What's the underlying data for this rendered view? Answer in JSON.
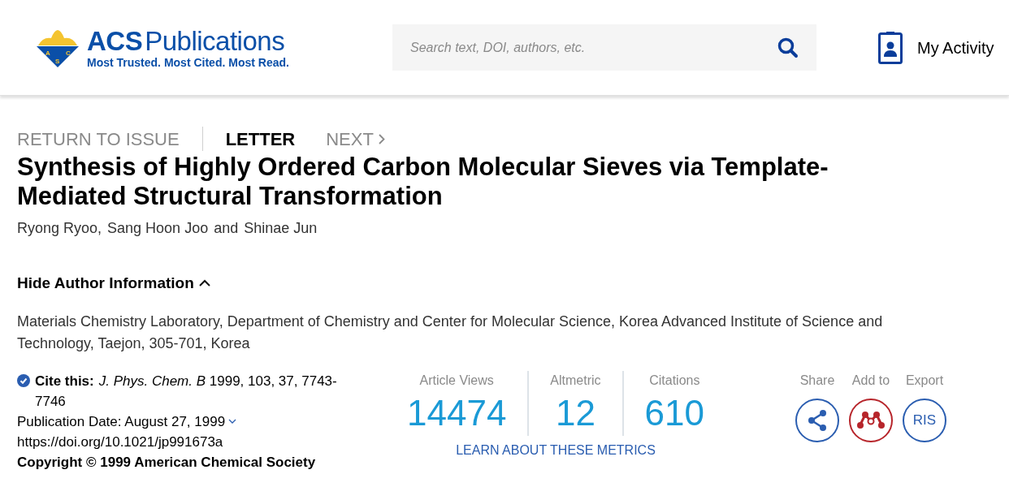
{
  "header": {
    "logo": {
      "wordmark_bold": "ACS",
      "wordmark": "Publications",
      "tagline": "Most Trusted. Most Cited. Most Read.",
      "emblem_letters": [
        "A",
        "C",
        "S"
      ]
    },
    "search": {
      "placeholder": "Search text, DOI, authors, etc."
    },
    "my_activity": "My Activity"
  },
  "article_nav": [
    {
      "label": "RETURN TO ISSUE",
      "selected": false,
      "kind": "link"
    },
    {
      "label": "LETTER",
      "selected": true,
      "kind": "type"
    },
    {
      "label": "NEXT",
      "selected": false,
      "kind": "next"
    }
  ],
  "title": "Synthesis of Highly Ordered Carbon Molecular Sieves via Template-Mediated Structural Transformation",
  "authors": [
    "Ryong Ryoo,",
    "Sang Hoon Joo",
    "and",
    "Shinae Jun"
  ],
  "author_info": {
    "toggle": "Hide Author Information",
    "expanded": true,
    "affiliation": "Materials Chemistry Laboratory, Department of Chemistry and Center for Molecular Science, Korea Advanced Institute of Science and Technology, Taejon, 305-701, Korea"
  },
  "citation": {
    "label": "Cite this:",
    "text": "*J. Phys. Chem. B* 1999, 103, 37, 7743-7746",
    "publication_date": "Publication Date: August 27, 1999",
    "doi": "https://doi.org/10.1021/jp991673a",
    "copyright": "Copyright © 1999 American Chemical Society"
  },
  "metrics": [
    {
      "label": "Article Views",
      "value": "14474"
    },
    {
      "label": "Altmetric",
      "value": "12"
    },
    {
      "label": "Citations",
      "value": "610"
    }
  ],
  "metrics_link": "LEARN ABOUT THESE METRICS",
  "actions": [
    {
      "label": "Share",
      "kind": "share"
    },
    {
      "label": "Add to",
      "kind": "mendeley"
    },
    {
      "label": "Export",
      "kind": "ris",
      "text": "RIS"
    }
  ]
}
